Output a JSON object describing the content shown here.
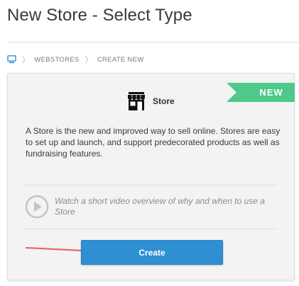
{
  "page": {
    "title": "New Store - Select Type"
  },
  "breadcrumb": {
    "home_icon": "computer-icon",
    "items": [
      "WEBSTORES",
      "CREATE NEW"
    ]
  },
  "card": {
    "badge": "NEW",
    "badge_color": "#4ec98a",
    "type_icon": "storefront-icon",
    "type_name": "Store",
    "description": "A Store is the new and improved way to sell online. Stores are easy to set up and launch, and support predecorated products as well as fundraising features.",
    "video_icon": "play-circle-icon",
    "video_text": "Watch a short video overview of why and when to use a Store",
    "create_label": "Create",
    "button_color": "#2f8fd3",
    "annotation_arrow_color": "#e8696b"
  }
}
